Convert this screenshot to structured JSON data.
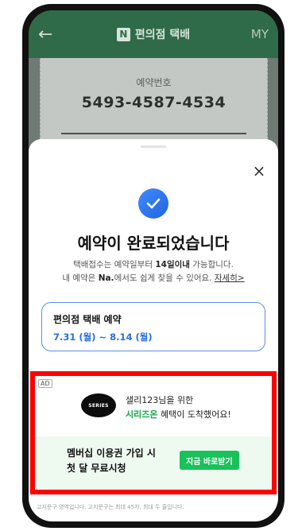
{
  "header": {
    "back_icon": "←",
    "logo_letter": "N",
    "title": "편의점 택배",
    "right": "MY"
  },
  "ticket": {
    "label": "예약번호",
    "number": "5493-4587-4534"
  },
  "sheet": {
    "close_icon": "×",
    "title": "예약이 완료되었습니다",
    "desc_line1_prefix": "택배접수는 예약일부터 ",
    "desc_line1_bold": "14일이내",
    "desc_line1_suffix": " 가능합니다.",
    "desc_line2_prefix": "내 예약은 ",
    "desc_line2_bold": "Na.",
    "desc_line2_suffix": "에서도 쉽게 찾을 수 있어요. ",
    "desc_link": "자세히>",
    "card_title": "편의점 택배 예약",
    "card_period": "7.31 (월) ~ 8.14 (월)"
  },
  "ad": {
    "badge": "AD",
    "logo_text": "SERIES",
    "line1": "샐리123님을 위한",
    "line2_highlight": "시리즈온",
    "line2_rest": " 혜택이 도착했어요!",
    "promo_line1": "멤버십 이용권 가입 시",
    "promo_line2": "첫 달 무료시청",
    "cta": "지금 바로받기",
    "footnote": "고지문구 영역입니다. 고지문구는 최대 45자, 최대 두 줄입니다."
  },
  "colors": {
    "accent_blue": "#2a6fe0",
    "accent_green": "#18c159",
    "highlight_frame": "#ff0000"
  }
}
